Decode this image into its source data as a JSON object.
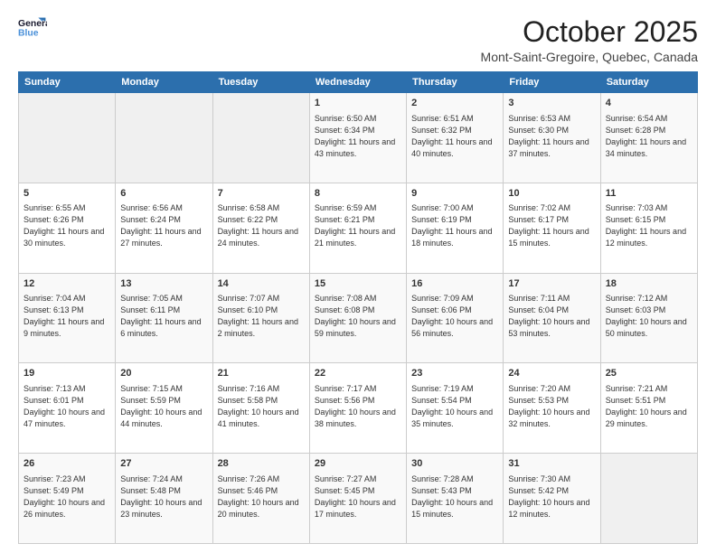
{
  "header": {
    "title": "October 2025",
    "subtitle": "Mont-Saint-Gregoire, Quebec, Canada"
  },
  "calendar": {
    "days": [
      "Sunday",
      "Monday",
      "Tuesday",
      "Wednesday",
      "Thursday",
      "Friday",
      "Saturday"
    ]
  },
  "rows": [
    [
      {
        "day": "",
        "info": ""
      },
      {
        "day": "",
        "info": ""
      },
      {
        "day": "",
        "info": ""
      },
      {
        "day": "1",
        "info": "Sunrise: 6:50 AM\nSunset: 6:34 PM\nDaylight: 11 hours\nand 43 minutes."
      },
      {
        "day": "2",
        "info": "Sunrise: 6:51 AM\nSunset: 6:32 PM\nDaylight: 11 hours\nand 40 minutes."
      },
      {
        "day": "3",
        "info": "Sunrise: 6:53 AM\nSunset: 6:30 PM\nDaylight: 11 hours\nand 37 minutes."
      },
      {
        "day": "4",
        "info": "Sunrise: 6:54 AM\nSunset: 6:28 PM\nDaylight: 11 hours\nand 34 minutes."
      }
    ],
    [
      {
        "day": "5",
        "info": "Sunrise: 6:55 AM\nSunset: 6:26 PM\nDaylight: 11 hours\nand 30 minutes."
      },
      {
        "day": "6",
        "info": "Sunrise: 6:56 AM\nSunset: 6:24 PM\nDaylight: 11 hours\nand 27 minutes."
      },
      {
        "day": "7",
        "info": "Sunrise: 6:58 AM\nSunset: 6:22 PM\nDaylight: 11 hours\nand 24 minutes."
      },
      {
        "day": "8",
        "info": "Sunrise: 6:59 AM\nSunset: 6:21 PM\nDaylight: 11 hours\nand 21 minutes."
      },
      {
        "day": "9",
        "info": "Sunrise: 7:00 AM\nSunset: 6:19 PM\nDaylight: 11 hours\nand 18 minutes."
      },
      {
        "day": "10",
        "info": "Sunrise: 7:02 AM\nSunset: 6:17 PM\nDaylight: 11 hours\nand 15 minutes."
      },
      {
        "day": "11",
        "info": "Sunrise: 7:03 AM\nSunset: 6:15 PM\nDaylight: 11 hours\nand 12 minutes."
      }
    ],
    [
      {
        "day": "12",
        "info": "Sunrise: 7:04 AM\nSunset: 6:13 PM\nDaylight: 11 hours\nand 9 minutes."
      },
      {
        "day": "13",
        "info": "Sunrise: 7:05 AM\nSunset: 6:11 PM\nDaylight: 11 hours\nand 6 minutes."
      },
      {
        "day": "14",
        "info": "Sunrise: 7:07 AM\nSunset: 6:10 PM\nDaylight: 11 hours\nand 2 minutes."
      },
      {
        "day": "15",
        "info": "Sunrise: 7:08 AM\nSunset: 6:08 PM\nDaylight: 10 hours\nand 59 minutes."
      },
      {
        "day": "16",
        "info": "Sunrise: 7:09 AM\nSunset: 6:06 PM\nDaylight: 10 hours\nand 56 minutes."
      },
      {
        "day": "17",
        "info": "Sunrise: 7:11 AM\nSunset: 6:04 PM\nDaylight: 10 hours\nand 53 minutes."
      },
      {
        "day": "18",
        "info": "Sunrise: 7:12 AM\nSunset: 6:03 PM\nDaylight: 10 hours\nand 50 minutes."
      }
    ],
    [
      {
        "day": "19",
        "info": "Sunrise: 7:13 AM\nSunset: 6:01 PM\nDaylight: 10 hours\nand 47 minutes."
      },
      {
        "day": "20",
        "info": "Sunrise: 7:15 AM\nSunset: 5:59 PM\nDaylight: 10 hours\nand 44 minutes."
      },
      {
        "day": "21",
        "info": "Sunrise: 7:16 AM\nSunset: 5:58 PM\nDaylight: 10 hours\nand 41 minutes."
      },
      {
        "day": "22",
        "info": "Sunrise: 7:17 AM\nSunset: 5:56 PM\nDaylight: 10 hours\nand 38 minutes."
      },
      {
        "day": "23",
        "info": "Sunrise: 7:19 AM\nSunset: 5:54 PM\nDaylight: 10 hours\nand 35 minutes."
      },
      {
        "day": "24",
        "info": "Sunrise: 7:20 AM\nSunset: 5:53 PM\nDaylight: 10 hours\nand 32 minutes."
      },
      {
        "day": "25",
        "info": "Sunrise: 7:21 AM\nSunset: 5:51 PM\nDaylight: 10 hours\nand 29 minutes."
      }
    ],
    [
      {
        "day": "26",
        "info": "Sunrise: 7:23 AM\nSunset: 5:49 PM\nDaylight: 10 hours\nand 26 minutes."
      },
      {
        "day": "27",
        "info": "Sunrise: 7:24 AM\nSunset: 5:48 PM\nDaylight: 10 hours\nand 23 minutes."
      },
      {
        "day": "28",
        "info": "Sunrise: 7:26 AM\nSunset: 5:46 PM\nDaylight: 10 hours\nand 20 minutes."
      },
      {
        "day": "29",
        "info": "Sunrise: 7:27 AM\nSunset: 5:45 PM\nDaylight: 10 hours\nand 17 minutes."
      },
      {
        "day": "30",
        "info": "Sunrise: 7:28 AM\nSunset: 5:43 PM\nDaylight: 10 hours\nand 15 minutes."
      },
      {
        "day": "31",
        "info": "Sunrise: 7:30 AM\nSunset: 5:42 PM\nDaylight: 10 hours\nand 12 minutes."
      },
      {
        "day": "",
        "info": ""
      }
    ]
  ]
}
